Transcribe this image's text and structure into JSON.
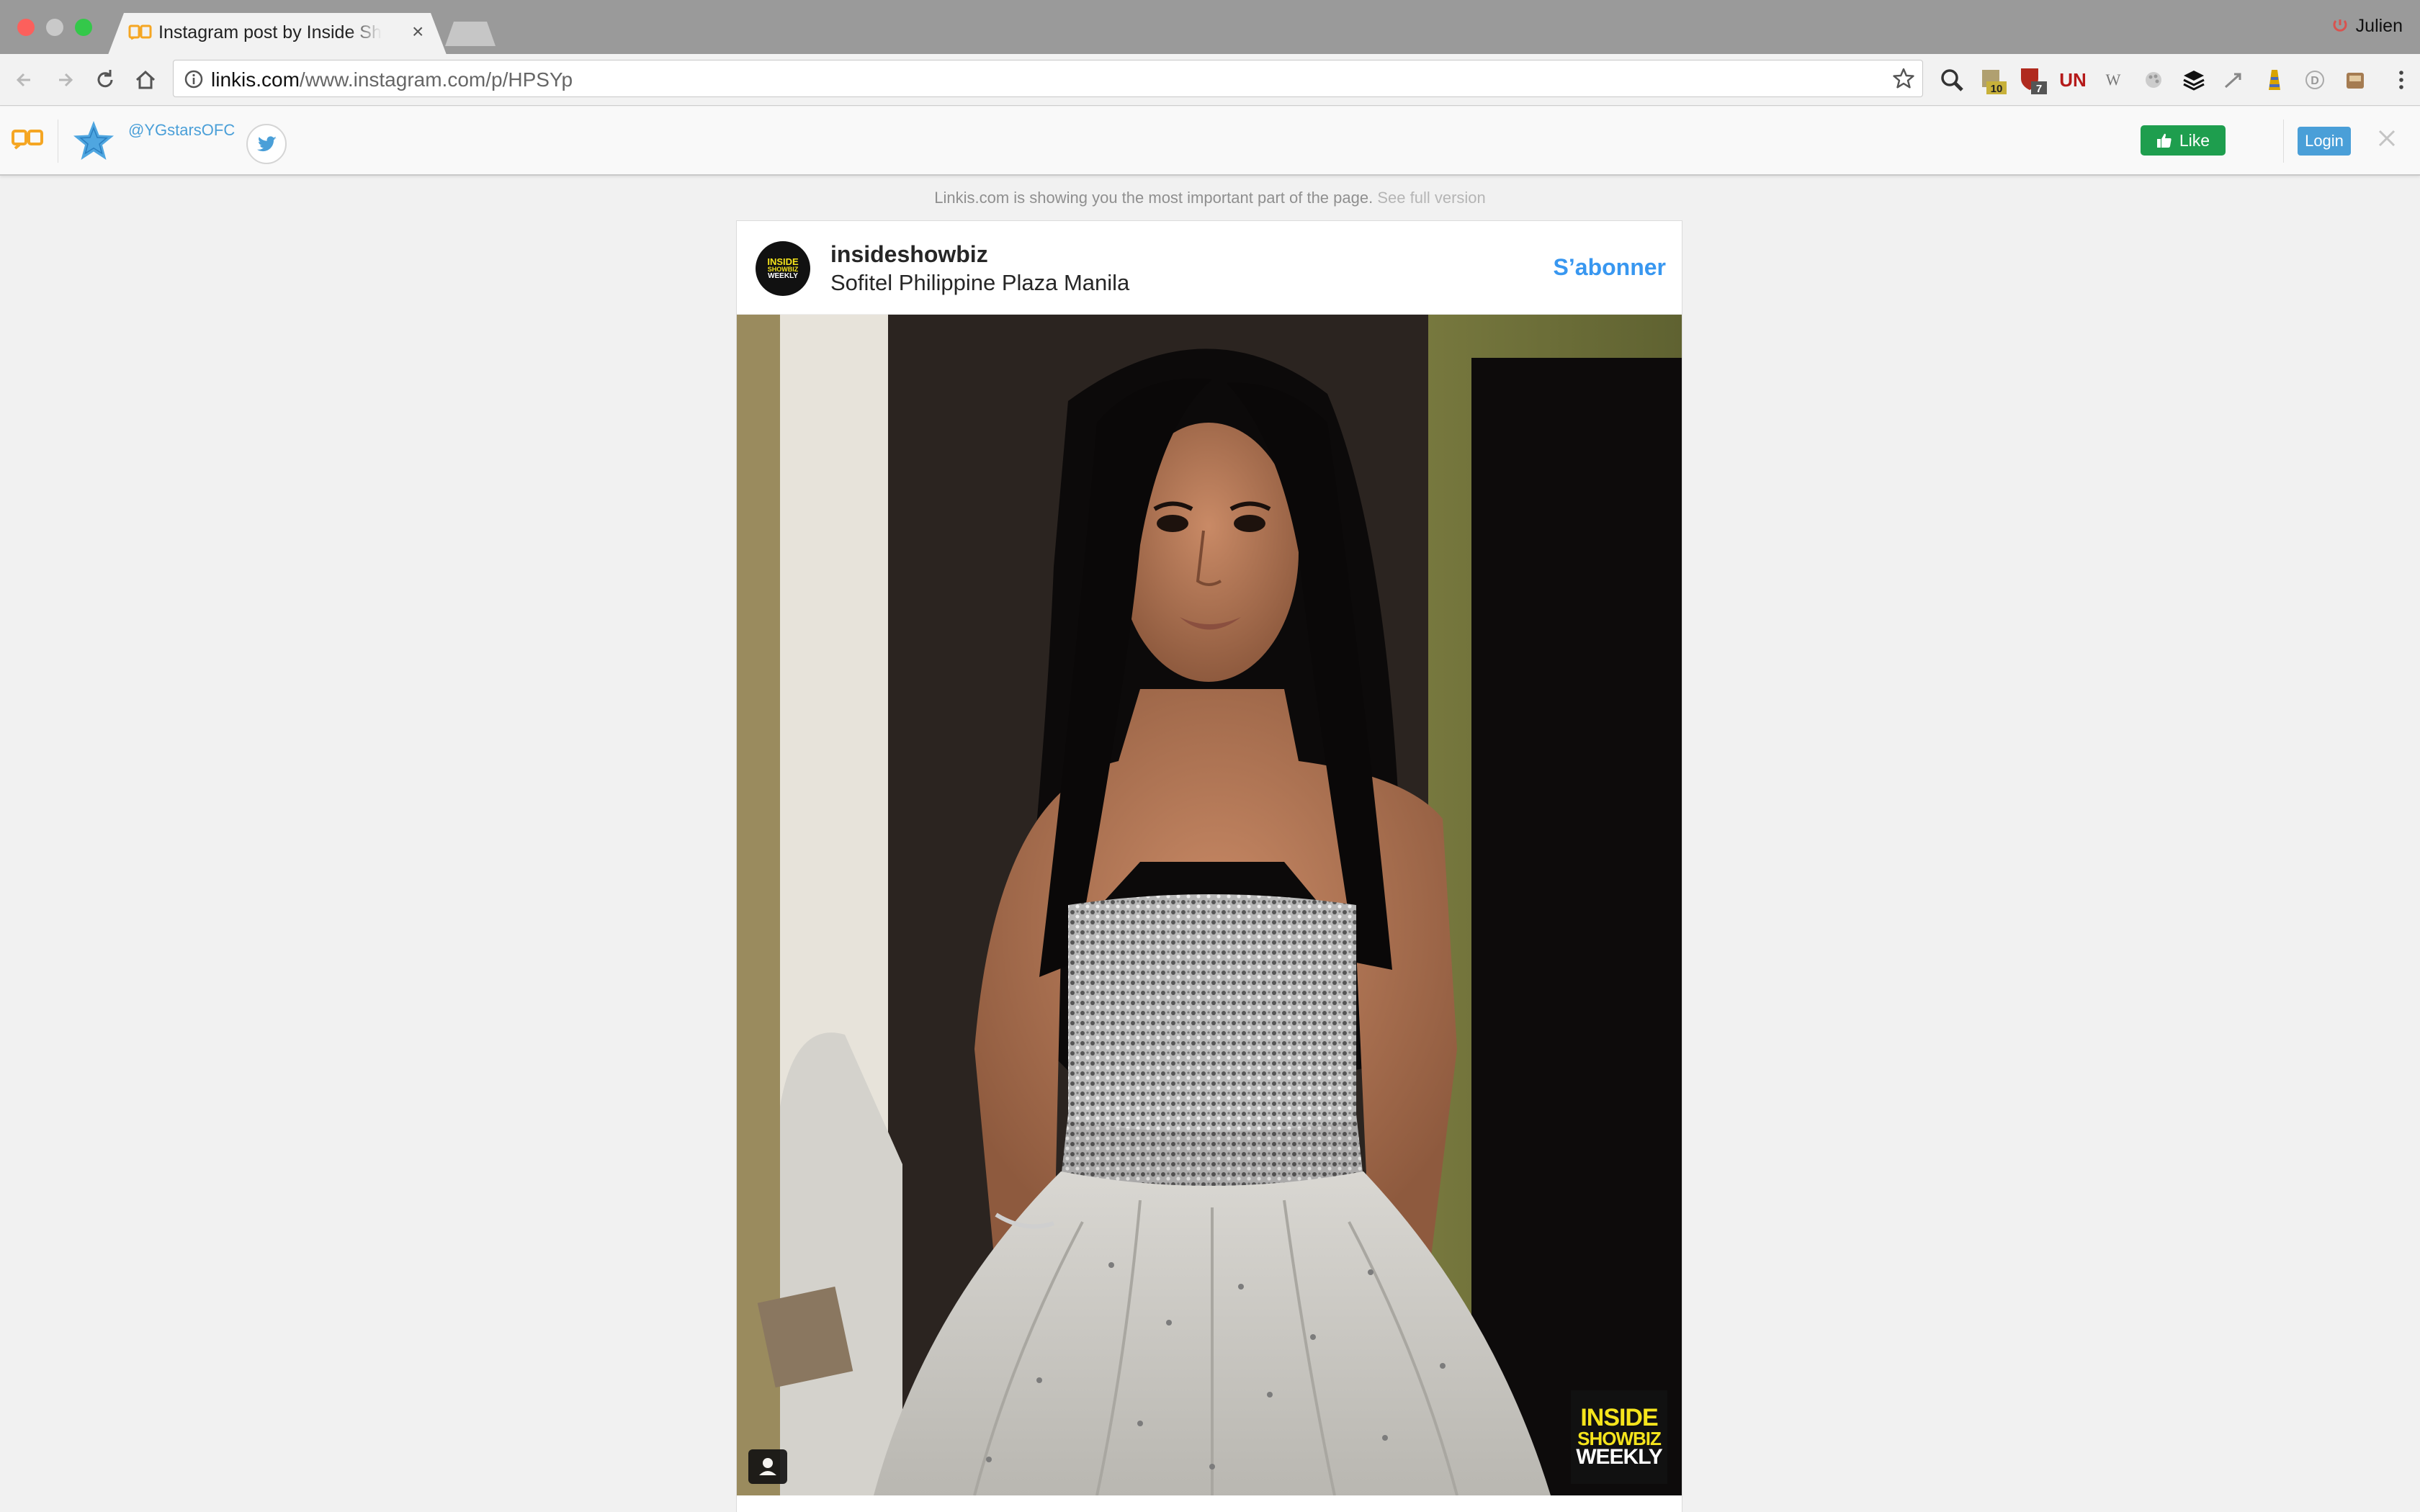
{
  "browser": {
    "tab_title": "Instagram post by Inside Showbiz Weekly",
    "profile_name": "Julien",
    "url_host": "linkis.com",
    "url_path": "/www.instagram.com/p/HPSYp",
    "extensions": [
      "search-icon",
      "calendar-badge-icon",
      "shield-badge-icon",
      "un-icon",
      "wikipedia-icon",
      "palette-icon",
      "buffer-icon",
      "share-icon",
      "lighthouse-icon",
      "d-icon",
      "archive-icon"
    ],
    "extension_badges": {
      "calendar": "10",
      "shield": "7"
    }
  },
  "linkis": {
    "handle": "@YGstarsOFC",
    "like_label": "Like",
    "login_label": "Login",
    "notice": "Linkis.com is showing you the most important part of the page.",
    "notice_link": "See full version"
  },
  "post": {
    "username": "insideshowbiz",
    "location": "Sofitel Philippine Plaza Manila",
    "follow_label": "S’abonner",
    "avatar_text": [
      "INSIDE",
      "SHOWBIZ",
      "WEEKLY"
    ],
    "watermark": [
      "INSIDE",
      "SHOWBIZ",
      "WEEKLY"
    ]
  },
  "colors": {
    "accent_blue": "#3897f0",
    "like_green": "#1e9e4e",
    "login_blue": "#4a9fd8",
    "watermark_yellow": "#f5e41c"
  }
}
